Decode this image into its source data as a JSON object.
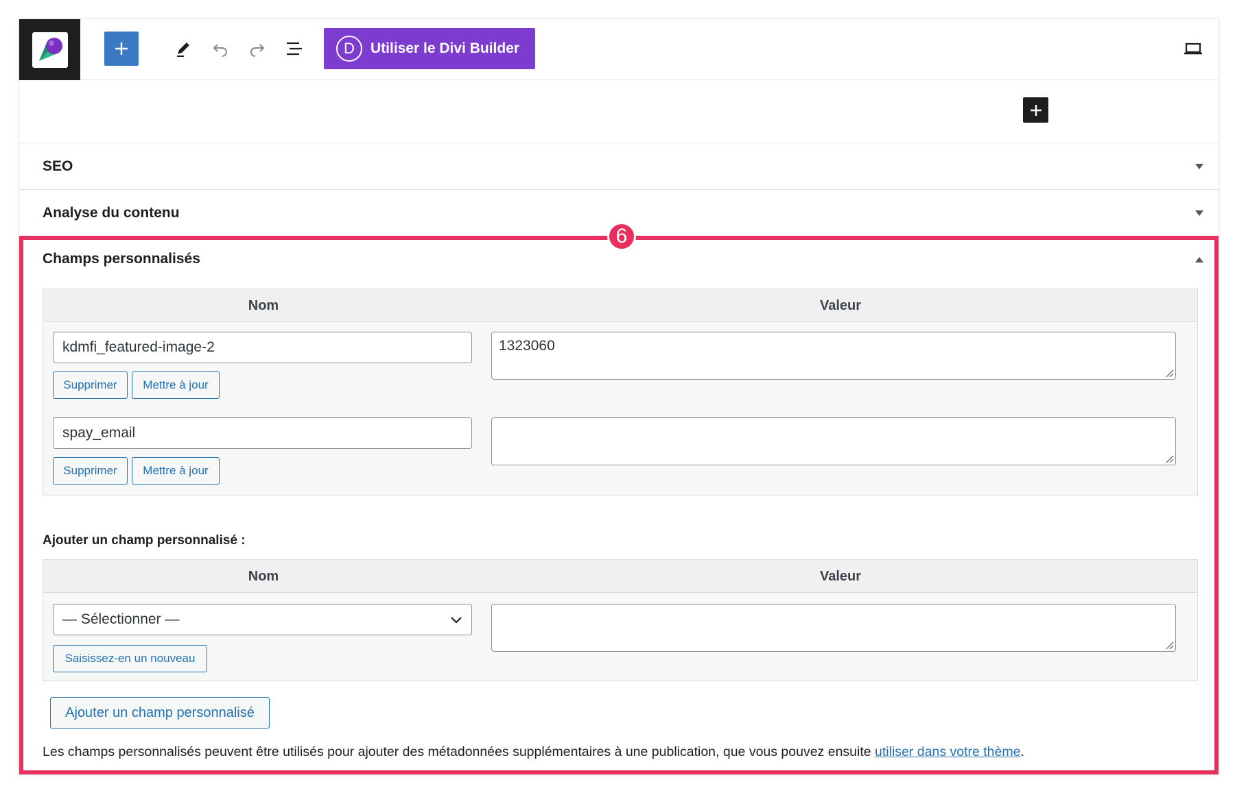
{
  "toolbar": {
    "divi_label": "Utiliser le Divi Builder",
    "divi_letter": "D"
  },
  "panels": {
    "seo": "SEO",
    "analysis": "Analyse du contenu"
  },
  "annotation": {
    "marker": "6",
    "color": "#e8305e"
  },
  "custom_fields": {
    "title": "Champs personnalisés",
    "headers": {
      "name": "Nom",
      "value": "Valeur"
    },
    "rows": [
      {
        "name": "kdmfi_featured-image-2",
        "value": "1323060",
        "delete_label": "Supprimer",
        "update_label": "Mettre à jour"
      },
      {
        "name": "spay_email",
        "value": "",
        "delete_label": "Supprimer",
        "update_label": "Mettre à jour"
      }
    ],
    "add_section": {
      "label": "Ajouter un champ personnalisé :",
      "select_value": "— Sélectionner —",
      "enter_new_label": "Saisissez-en un nouveau",
      "value": ""
    },
    "add_button_label": "Ajouter un champ personnalisé",
    "help_text": "Les champs personnalisés peuvent être utilisés pour ajouter des métadonnées supplémentaires à une publication, que vous pouvez ensuite ",
    "help_link": "utiliser dans votre thème",
    "help_end": "."
  },
  "colors": {
    "accent_blue": "#3a7ac4",
    "divi_purple": "#7e3bd0",
    "link_blue": "#2271b1"
  }
}
